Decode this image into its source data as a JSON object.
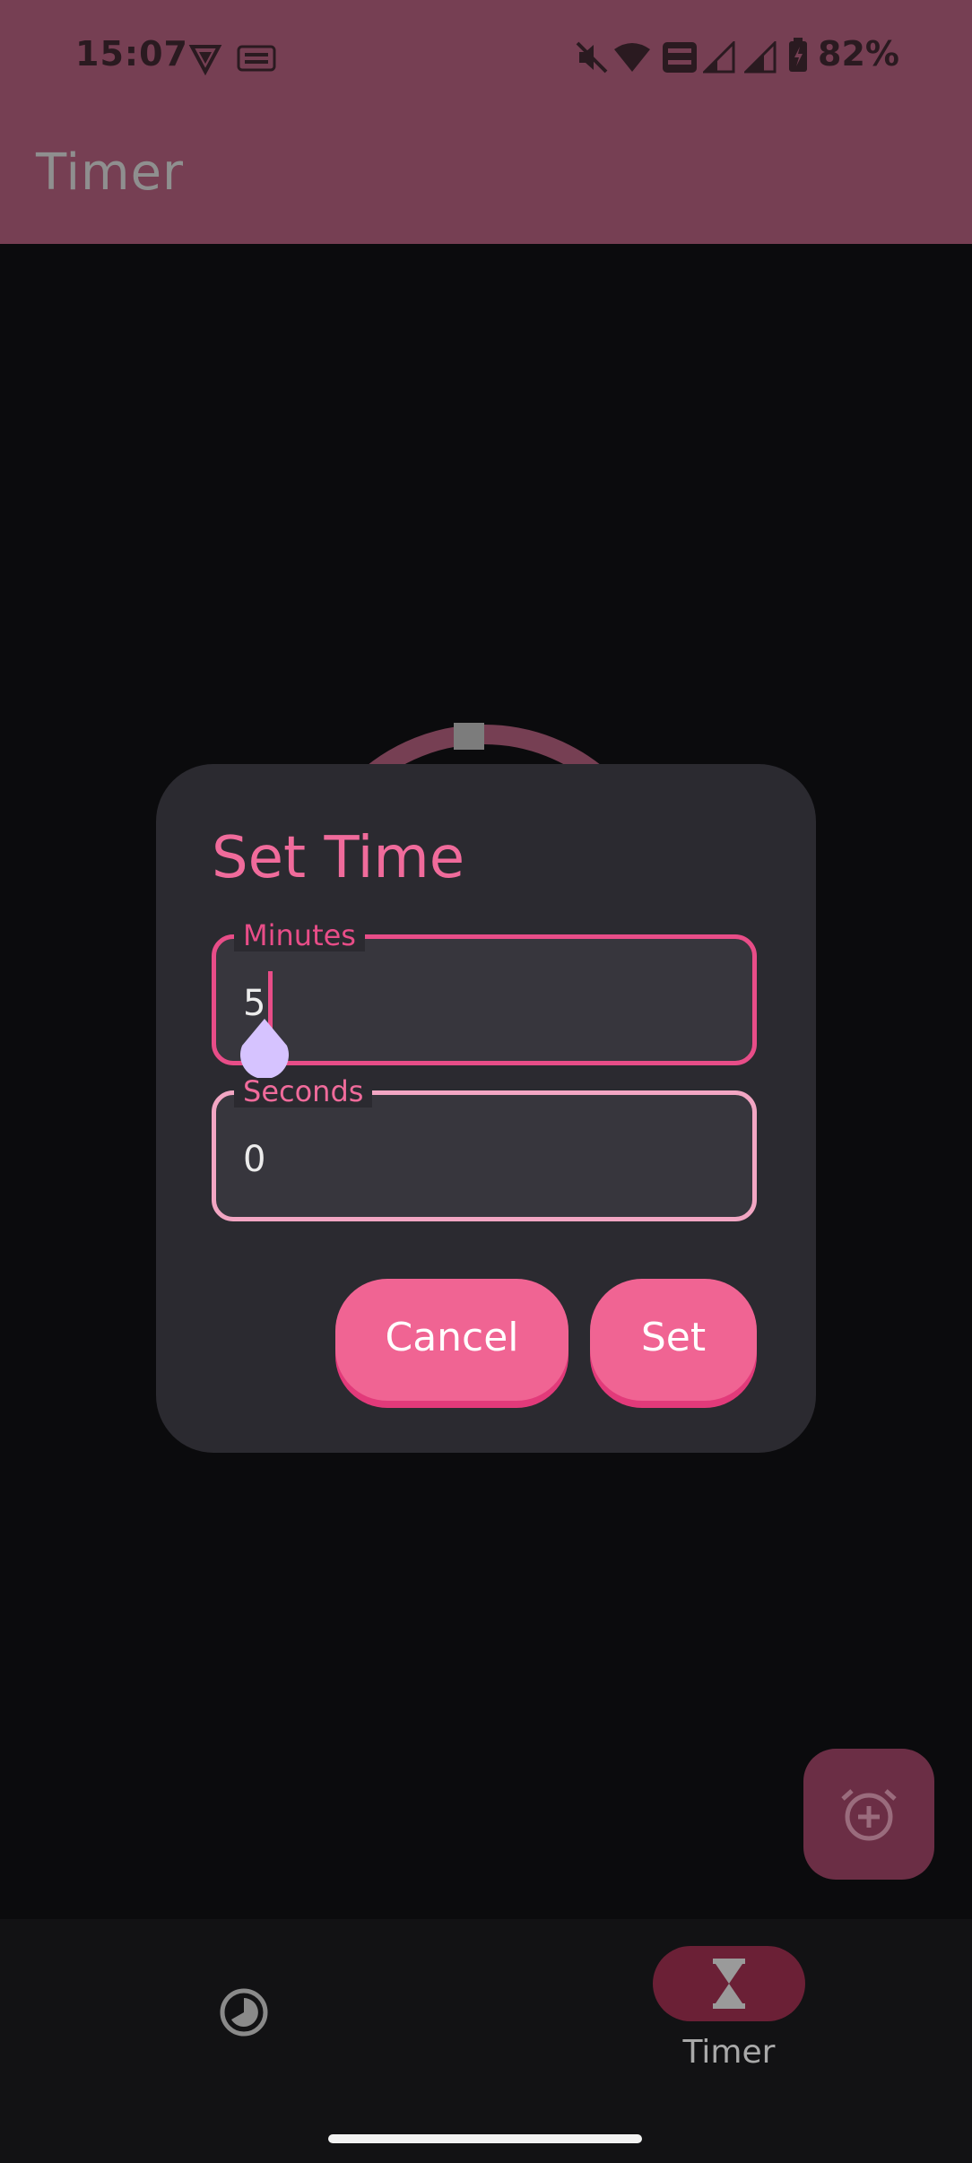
{
  "status_bar": {
    "time": "15:07",
    "battery": "82%",
    "icons": [
      "vpn-icon",
      "temu-icon",
      "mute-icon",
      "wifi-icon",
      "volte-wifi-icon",
      "signal-icon",
      "signal-icon-2",
      "battery-icon"
    ]
  },
  "app_bar": {
    "title": "Timer"
  },
  "dialog": {
    "title": "Set Time",
    "minutes": {
      "label": "Minutes",
      "value": "5"
    },
    "seconds": {
      "label": "Seconds",
      "value": "0"
    },
    "cancel_label": "Cancel",
    "set_label": "Set"
  },
  "fab": {
    "icon": "add-alarm-icon"
  },
  "bottom_nav": {
    "items": [
      {
        "icon": "clock-icon",
        "label": ""
      },
      {
        "icon": "hourglass-icon",
        "label": "Timer"
      }
    ]
  },
  "colors": {
    "accent": "#f06493",
    "app_bar": "#763f53",
    "dialog_bg": "#2b2a30",
    "background": "#0b0b0d"
  }
}
